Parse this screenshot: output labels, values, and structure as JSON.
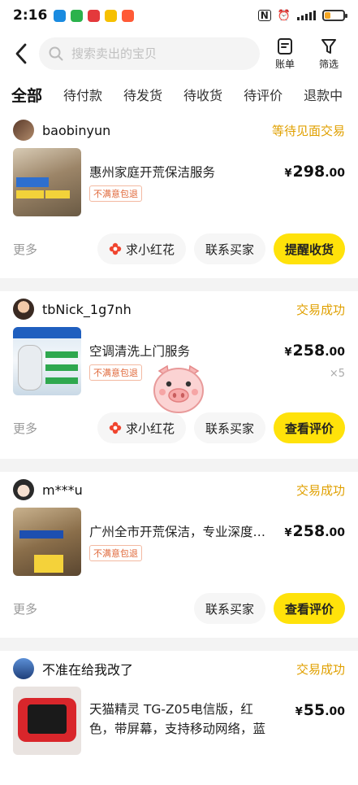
{
  "status_bar": {
    "time": "2:16"
  },
  "search": {
    "placeholder": "搜索卖出的宝贝"
  },
  "header": {
    "bills_label": "账单",
    "filter_label": "筛选"
  },
  "tabs": [
    {
      "label": "全部",
      "active": true
    },
    {
      "label": "待付款"
    },
    {
      "label": "待发货"
    },
    {
      "label": "待收货"
    },
    {
      "label": "待评价"
    },
    {
      "label": "退款中"
    }
  ],
  "orders": [
    {
      "seller": "baobinyun",
      "status": "等待见面交易",
      "title": "惠州家庭开荒保洁服务",
      "tag": "不满意包退",
      "price_int": "298",
      "price_dec": ".00",
      "yen": "¥",
      "more": "更多",
      "buttons": [
        "求小红花",
        "联系买家",
        "提醒收货"
      ]
    },
    {
      "seller": "tbNick_1g7nh",
      "status": "交易成功",
      "title": "空调清洗上门服务",
      "tag": "不满意包退",
      "price_int": "258",
      "price_dec": ".00",
      "yen": "¥",
      "qty": "×5",
      "more": "更多",
      "buttons": [
        "求小红花",
        "联系买家",
        "查看评价"
      ]
    },
    {
      "seller": "m***u",
      "status": "交易成功",
      "title": "广州全市开荒保洁，专业深度…",
      "tag": "不满意包退",
      "price_int": "258",
      "price_dec": ".00",
      "yen": "¥",
      "more": "更多",
      "buttons": [
        "联系买家",
        "查看评价"
      ]
    },
    {
      "seller": "不准在给我改了",
      "status": "交易成功",
      "title": "天猫精灵 TG-Z05电信版，红色，带屏幕，支持移动网络，蓝",
      "price_int": "55",
      "price_dec": ".00",
      "yen": "¥"
    }
  ],
  "colors": {
    "accent": "#ffe20a",
    "status": "#e0a000"
  }
}
